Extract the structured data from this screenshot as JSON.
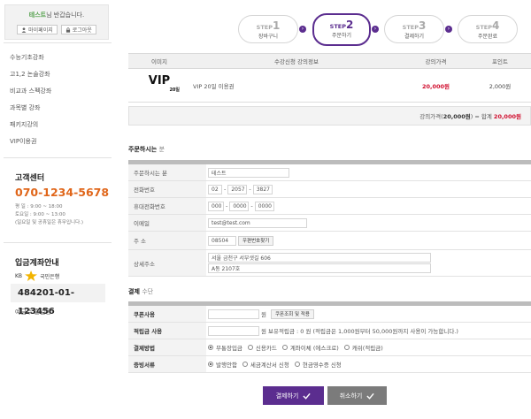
{
  "sidebar": {
    "welcome": {
      "name": "테스트",
      "suffix": "님 반갑습니다."
    },
    "mypage_label": "마이페이지",
    "logout_label": "로그아웃",
    "menu": [
      {
        "label": "수능기초강좌"
      },
      {
        "label": "고1,2 논술강좌"
      },
      {
        "label": "비교과 스펙강좌"
      },
      {
        "label": "과목별 강좌"
      },
      {
        "label": "패키지강의"
      },
      {
        "label": "VIP이용권"
      }
    ],
    "cs": {
      "title": "고객센터",
      "phone": "070-1234-5678",
      "hours1": "평 일 : 9:00 ~ 18:00",
      "hours2": "토요일 : 9:00 ~ 13:00",
      "note": "(일요일 및 공휴일은 휴무입니다.)"
    },
    "bank": {
      "title": "입금계좌안내",
      "bank_code": "KB",
      "bank_name": "국민은행",
      "account": "484201-01-123456",
      "owner": "예금주 홍길동"
    }
  },
  "steps": [
    {
      "num": "1",
      "label": "장바구니",
      "active": false
    },
    {
      "num": "2",
      "label": "주문하기",
      "active": true
    },
    {
      "num": "3",
      "label": "결제하기",
      "active": false
    },
    {
      "num": "4",
      "label": "주문완료",
      "active": false
    }
  ],
  "step_prefix": "STEP",
  "product_table": {
    "headers": [
      "이미지",
      "수강신청 강의정보",
      "강의가격",
      "포인트"
    ],
    "row": {
      "image_text": "VIP",
      "image_sub": "20일",
      "name": "VIP 20일 이용권",
      "price": "20,000원",
      "point": "2,000원"
    },
    "total": {
      "label": "강의가격(",
      "amount": "20,000원",
      "mid": ") = 합계 ",
      "sum": "20,000원"
    }
  },
  "orderer": {
    "title": "주문하시는",
    "title_suffix": "분",
    "rows": {
      "name_label": "주문하시는 분",
      "name_value": "테스트",
      "phone_label": "전화번호",
      "phone1": "02",
      "phone2": "2057",
      "phone3": "3827",
      "mobile_label": "휴대전화번호",
      "mobile1": "000",
      "mobile2": "0000",
      "mobile3": "0000",
      "email_label": "이메일",
      "email_value": "test@test.com",
      "zip_label": "주 소",
      "zip_value": "08504",
      "zip_button": "우편번호찾기",
      "addr_label": "상세주소",
      "addr1": "서울 금천구 서부샛길 606",
      "addr2": "A동 2107호"
    }
  },
  "payment": {
    "title": "결제",
    "title_suffix": "수단",
    "coupon_label": "쿠폰사용",
    "coupon_unit": "원",
    "coupon_button": "쿠폰조회 및 적용",
    "points_label": "적립금 사용",
    "points_text": "원 보유적립금 : 0 원 (적립금은 1,000원부터 50,000원까지 사용이 가능합니다.)",
    "method_label": "결제방법",
    "methods": [
      {
        "label": "무통장입금",
        "checked": true
      },
      {
        "label": "신용카드",
        "checked": false
      },
      {
        "label": "계좌이체 (에스크로)",
        "checked": false
      },
      {
        "label": "캐쉬(적립금)",
        "checked": false
      }
    ],
    "receipt_label": "증빙서류",
    "receipts": [
      {
        "label": "발행안함",
        "checked": true
      },
      {
        "label": "세금계산서 신청",
        "checked": false
      },
      {
        "label": "현금영수증 신청",
        "checked": false
      }
    ]
  },
  "buttons": {
    "pay": "결제하기",
    "cancel": "취소하기"
  },
  "colors": {
    "accent": "#5b2d8f",
    "phone": "#e0661a",
    "price": "#d00d2d",
    "cancel": "#7b7b7b"
  }
}
